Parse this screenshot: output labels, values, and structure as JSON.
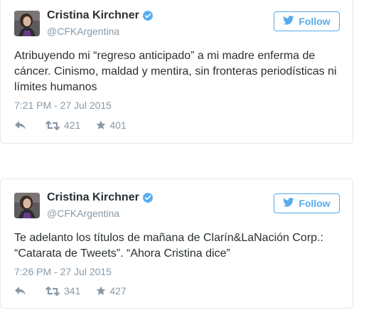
{
  "colors": {
    "accent": "#55acee",
    "verified": "#55acee",
    "text": "#292f33",
    "muted": "#8899a6",
    "border": "#e1e8ed"
  },
  "tweets": [
    {
      "name": "Cristina Kirchner",
      "handle": "@CFKArgentina",
      "follow_label": "Follow",
      "text": "Atribuyendo mi “regreso anticipado” a mi madre enferma de cáncer. Cinismo, maldad y mentira, sin fronteras periodísticas ni límites humanos",
      "timestamp": "7:21 PM - 27 Jul 2015",
      "retweets": "421",
      "favorites": "401",
      "icons": [
        "avatar",
        "verified-badge-icon",
        "bird-icon",
        "reply-icon",
        "retweet-icon",
        "star-icon"
      ]
    },
    {
      "name": "Cristina Kirchner",
      "handle": "@CFKArgentina",
      "follow_label": "Follow",
      "text": "Te adelanto los títulos de mañana de Clarín&LaNación Corp.: “Catarata de Tweets”. “Ahora Cristina dice”",
      "timestamp": "7:26 PM - 27 Jul 2015",
      "retweets": "341",
      "favorites": "427",
      "icons": [
        "avatar",
        "verified-badge-icon",
        "bird-icon",
        "reply-icon",
        "retweet-icon",
        "star-icon"
      ]
    }
  ]
}
